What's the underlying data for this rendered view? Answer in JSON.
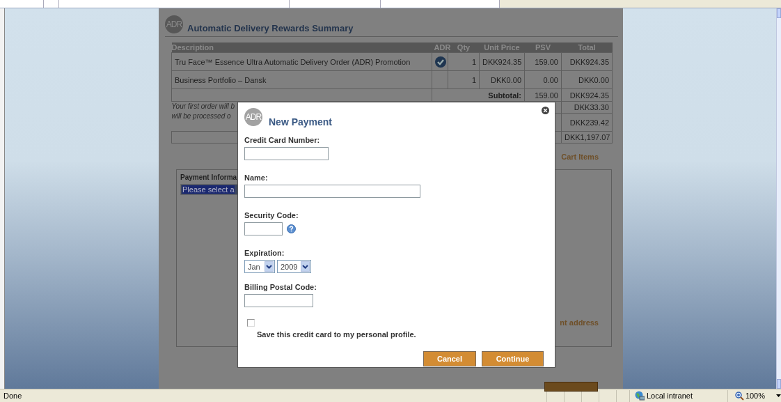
{
  "summary": {
    "logo": "ADR",
    "title": "Automatic Delivery Rewards Summary",
    "columns": [
      "Description",
      "ADR",
      "Qty",
      "Unit Price",
      "PSV",
      "Total"
    ],
    "rows": [
      {
        "description": "Tru Face™ Essence Ultra Automatic Delivery Order (ADR) Promotion",
        "adr": true,
        "qty": "1",
        "unit_price": "DKK924.35",
        "psv": "159.00",
        "total": "DKK924.35"
      },
      {
        "description": "Business Portfolio – Dansk",
        "adr": false,
        "qty": "1",
        "unit_price": "DKK0.00",
        "psv": "0.00",
        "total": "DKK0.00"
      }
    ],
    "subtotal": {
      "label": "Subtotal:",
      "psv": "159.00",
      "total": "DKK924.35"
    },
    "note_lines": [
      "Your first order will b",
      "will be processed o"
    ],
    "extra_totals": [
      "DKK33.30",
      "DKK239.42",
      "DKK1,197.07"
    ]
  },
  "cart_link": "Cart Items",
  "payment": {
    "title": "Payment Informa",
    "select_value": "Please select a",
    "link": "nt address"
  },
  "modal": {
    "logo": "ADR",
    "title": "New Payment",
    "card_number": {
      "label": "Credit Card Number:"
    },
    "name": {
      "label": "Name:"
    },
    "security_code": {
      "label": "Security Code:"
    },
    "expiration": {
      "label": "Expiration:",
      "month": "Jan",
      "year": "2009"
    },
    "postal_code": {
      "label": "Billing Postal Code:"
    },
    "save_card": {
      "label": "Save this credit card to my personal profile.",
      "checked": false
    },
    "buttons": [
      "Cancel",
      "Continue"
    ]
  },
  "status_bar": {
    "status": "Done",
    "zone": "Local intranet",
    "zoom": "100%"
  }
}
